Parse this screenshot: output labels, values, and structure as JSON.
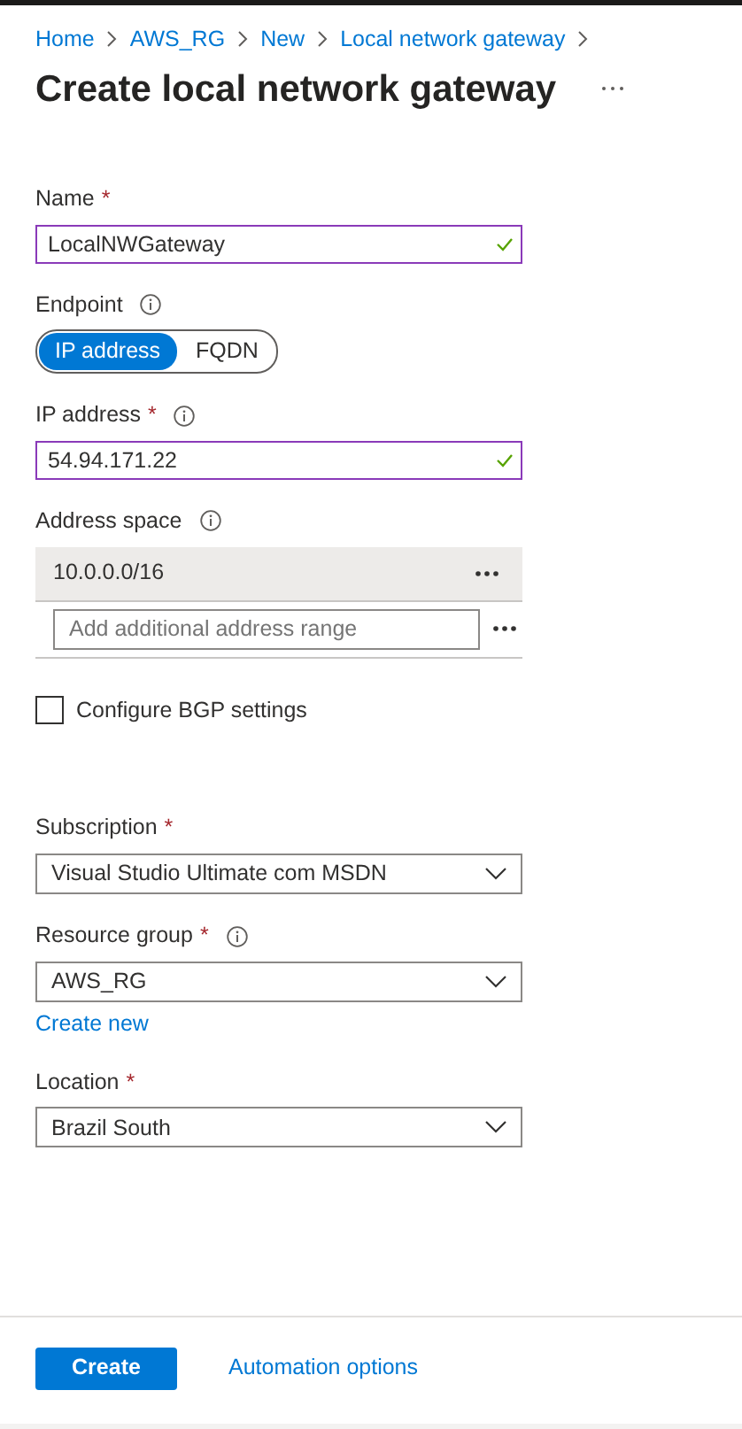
{
  "breadcrumb": [
    "Home",
    "AWS_RG",
    "New",
    "Local network gateway"
  ],
  "title": "Create local network gateway",
  "sections": [
    {
      "fields": [
        {
          "kind": "text",
          "label": "Name",
          "required_mark": "*",
          "value": "LocalNWGateway",
          "valid": true
        },
        {
          "kind": "toggle",
          "label": "Endpoint",
          "info": true,
          "options": [
            {
              "label": "IP address",
              "selected": true
            },
            {
              "label": "FQDN",
              "selected": false
            }
          ]
        },
        {
          "kind": "text",
          "label": "IP address",
          "required_mark": "*",
          "info": true,
          "value": "54.94.171.22",
          "valid": true
        },
        {
          "kind": "address_space",
          "label": "Address space",
          "info": true,
          "items": [
            "10.0.0.0/16"
          ],
          "placeholder": "Add additional address range"
        },
        {
          "kind": "checkbox",
          "label": "Configure BGP settings",
          "checked": false
        }
      ]
    },
    {
      "fields": [
        {
          "kind": "select",
          "label": "Subscription",
          "required_mark": "*",
          "value": "Visual Studio Ultimate com MSDN"
        },
        {
          "kind": "select",
          "label": "Resource group",
          "required_mark": "*",
          "info": true,
          "value": "AWS_RG",
          "link": "Create new"
        },
        {
          "kind": "select",
          "label": "Location",
          "required_mark": "*",
          "value": "Brazil South"
        }
      ]
    }
  ],
  "footer": {
    "primary": "Create",
    "link": "Automation options"
  }
}
